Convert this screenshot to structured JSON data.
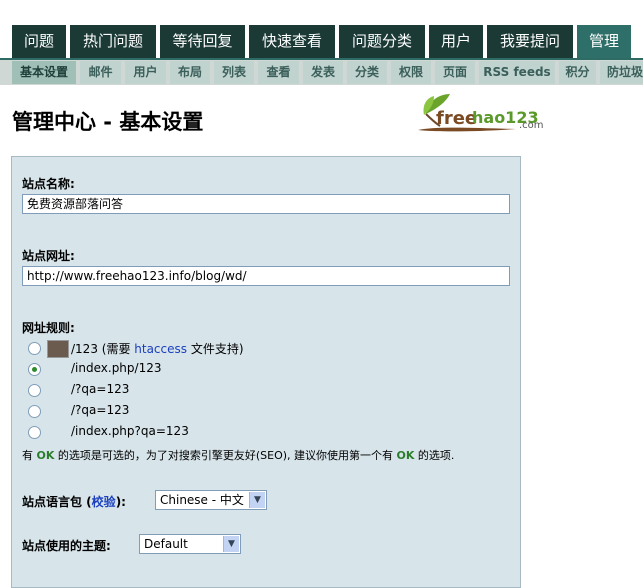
{
  "top_nav": {
    "tabs": [
      "问题",
      "热门问题",
      "等待回复",
      "快速查看",
      "问题分类",
      "用户",
      "我要提问",
      "管理"
    ],
    "active_index": 7
  },
  "sub_nav": {
    "tabs": [
      "基本设置",
      "邮件",
      "用户",
      "布局",
      "列表",
      "查看",
      "发表",
      "分类",
      "权限",
      "页面",
      "RSS feeds",
      "积分",
      "防垃圾"
    ],
    "active_index": 0
  },
  "page": {
    "title": "管理中心 - 基本设置"
  },
  "logo": {
    "text_free": "free",
    "text_hao": "hao123",
    "text_com": ".com"
  },
  "form": {
    "site_name_label": "站点名称:",
    "site_name_value": "免费资源部落问答",
    "site_url_label": "站点网址:",
    "site_url_value": "http://www.freehao123.info/blog/wd/",
    "url_rule_label": "网址规则:",
    "url_rules": [
      {
        "pre": "/123 (需要 ",
        "link": "htaccess",
        "post": " 文件支持)",
        "checked": false,
        "has_thumb": true
      },
      {
        "pre": "/index.php/123",
        "link": "",
        "post": "",
        "checked": true,
        "has_thumb": false
      },
      {
        "pre": "/?qa=123",
        "link": "",
        "post": "",
        "checked": false,
        "has_thumb": false
      },
      {
        "pre": "/?qa=123",
        "link": "",
        "post": "",
        "checked": false,
        "has_thumb": false
      },
      {
        "pre": "/index.php?qa=123",
        "link": "",
        "post": "",
        "checked": false,
        "has_thumb": false
      }
    ],
    "note": {
      "part1": "有 ",
      "ok1": "OK",
      "part2": " 的选项是可选的，为了对搜索引擎更友好(SEO), 建议你使用第一个有 ",
      "ok2": "OK",
      "part3": " 的选项."
    },
    "lang_label_pre": "站点语言包 (",
    "lang_label_link": "校验",
    "lang_label_post": "):",
    "lang_value": "Chinese - 中文",
    "theme_label": "站点使用的主题:",
    "theme_value": "Default"
  },
  "colors": {
    "tab_dark": "#1b3a36",
    "tab_active": "#2e6f69",
    "subnav_bg": "#c1d3cf",
    "panel_bg": "#d7e4ea",
    "ok_green": "#2a7d2a",
    "link_blue": "#1a3fbf"
  },
  "icons": {
    "select_arrow": "chevron-down-icon",
    "logo_leaf": "leaf-icon"
  }
}
